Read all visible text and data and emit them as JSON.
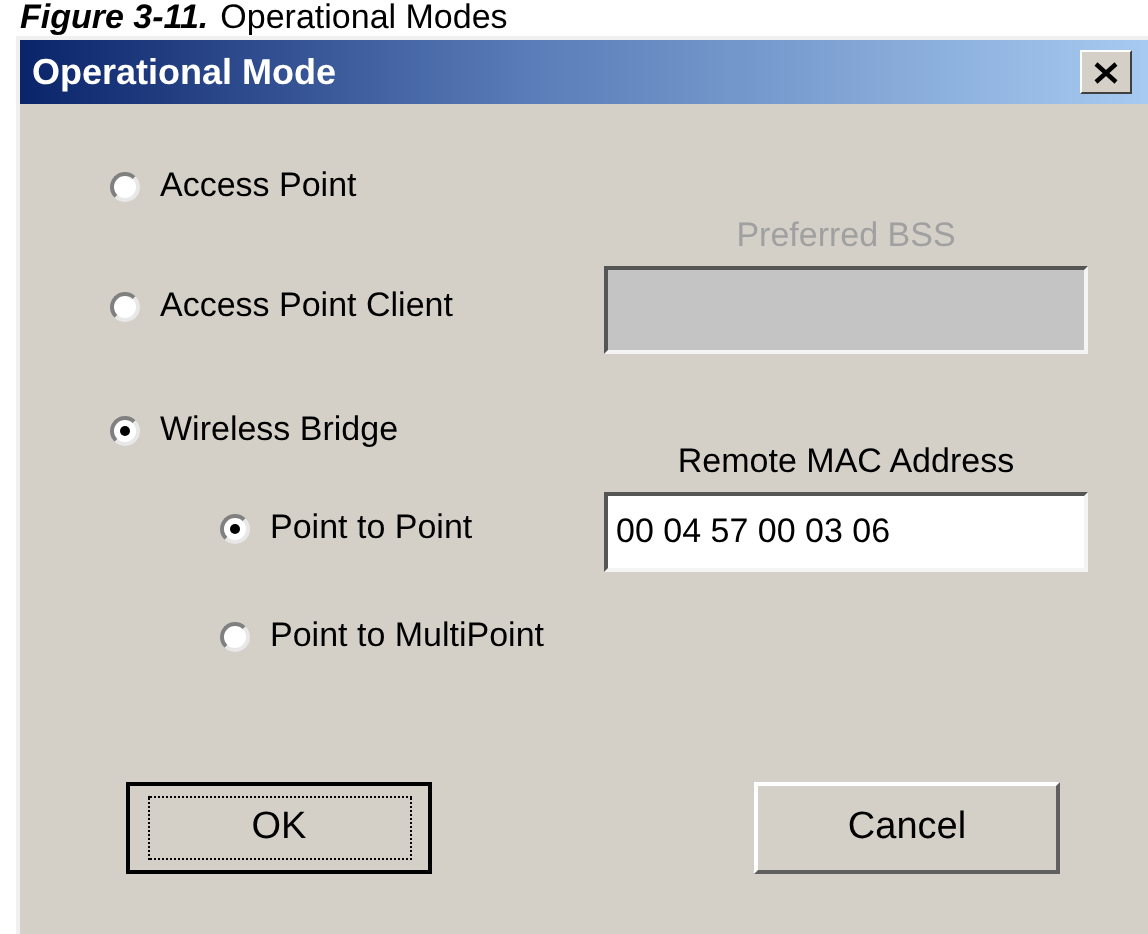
{
  "caption": {
    "label": "Figure 3-11.",
    "title": "Operational Modes"
  },
  "window": {
    "title": "Operational Mode"
  },
  "modes": [
    {
      "label": "Access Point",
      "selected": false
    },
    {
      "label": "Access Point Client",
      "selected": false
    },
    {
      "label": "Wireless Bridge",
      "selected": true,
      "children": [
        {
          "label": "Point to Point",
          "selected": true
        },
        {
          "label": "Point to MultiPoint",
          "selected": false
        }
      ]
    }
  ],
  "preferred_bss": {
    "label": "Preferred BSS",
    "disabled": true
  },
  "remote_mac": {
    "label": "Remote MAC Address",
    "value": "00 04 57 00 03 06",
    "disabled": false
  },
  "buttons": [
    {
      "label": "OK",
      "default": true
    },
    {
      "label": "Cancel",
      "default": false
    }
  ]
}
